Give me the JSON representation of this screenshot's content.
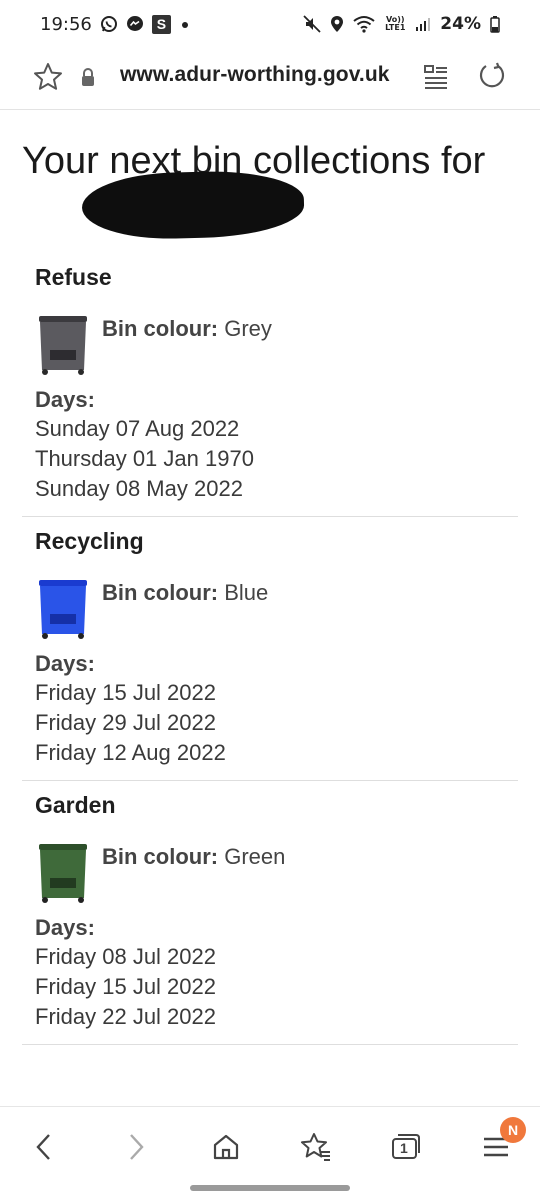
{
  "status_bar": {
    "time": "19:56",
    "left_icons": [
      "whatsapp-icon",
      "messenger-icon",
      "s-app-icon",
      "dot-icon"
    ],
    "right_icons": [
      "mute-icon",
      "location-icon",
      "wifi-icon",
      "volte-icon",
      "signal-icon",
      "battery-icon"
    ],
    "volte_text": "Vo)) LTE1",
    "battery": "24%",
    "s_app_letter": "S"
  },
  "browser": {
    "url": "www.adur-worthing.gov.uk"
  },
  "page": {
    "title": "Your next bin collections for"
  },
  "bins": [
    {
      "name": "Refuse",
      "colour_label": "Bin colour:",
      "colour": "Grey",
      "colour_hex": "#5b5a5f",
      "days_label": "Days:",
      "days": [
        "Sunday 07 Aug 2022",
        "Thursday 01 Jan 1970",
        "Sunday 08 May 2022"
      ]
    },
    {
      "name": "Recycling",
      "colour_label": "Bin colour:",
      "colour": "Blue",
      "colour_hex": "#2a54e8",
      "days_label": "Days:",
      "days": [
        "Friday 15 Jul 2022",
        "Friday 29 Jul 2022",
        "Friday 12 Aug 2022"
      ]
    },
    {
      "name": "Garden",
      "colour_label": "Bin colour:",
      "colour": "Green",
      "colour_hex": "#3f6a3a",
      "days_label": "Days:",
      "days": [
        "Friday 08 Jul 2022",
        "Friday 15 Jul 2022",
        "Friday 22 Jul 2022"
      ]
    }
  ],
  "bottom_nav": {
    "items": [
      "back-icon",
      "forward-icon",
      "home-icon",
      "bookmarks-icon",
      "tabs-icon",
      "menu-icon"
    ],
    "tabs_count": "1",
    "menu_badge": "N",
    "badge_color": "#f0783c"
  }
}
